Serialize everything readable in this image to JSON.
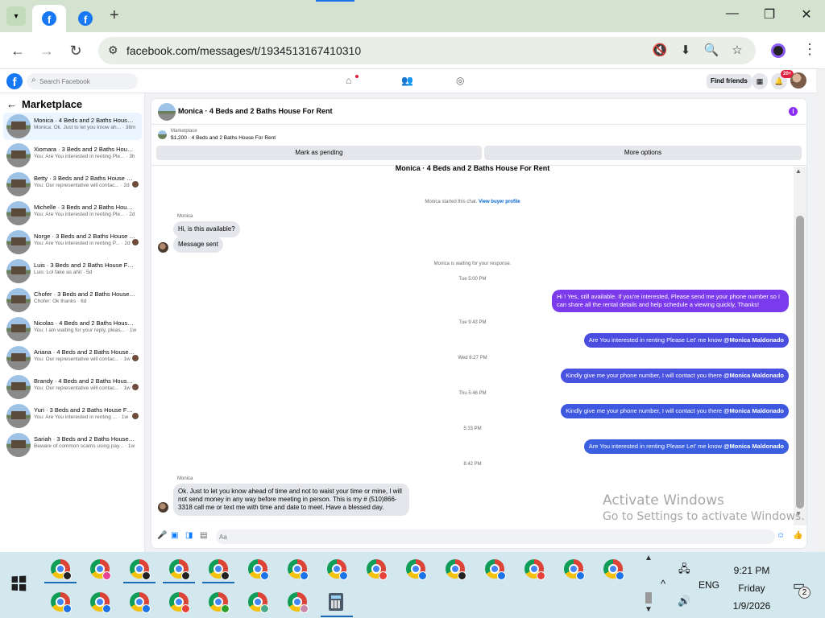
{
  "browser": {
    "url": "facebook.com/messages/t/1934513167410310",
    "tab_favicon": "facebook-icon",
    "new_tab_label": "+",
    "window_controls": [
      "—",
      "❐",
      "✕"
    ]
  },
  "fb": {
    "logo": "f",
    "search_placeholder": "Search Facebook",
    "find_friends": "Find friends",
    "notification_badge": "20+"
  },
  "sidebar": {
    "title": "Marketplace",
    "conversations": [
      {
        "name": "Monica · 4 Beds and 2 Baths House For Rent",
        "snippet": "Monica: Ok. Just to let you know ah... · 38m",
        "selected": true
      },
      {
        "name": "Xiomara · 3 Beds and 2 Baths House For Rent",
        "snippet": "You: Are You interested in renting Ple... · 3h"
      },
      {
        "name": "Betty · 3 Beds and 2 Baths House For Rent",
        "snippet": "You: Our representative will contac... · 2d"
      },
      {
        "name": "Michelle · 3 Beds and 2 Baths House For Rent",
        "snippet": "You: Are You interested in renting Ple... · 2d"
      },
      {
        "name": "Norge · 3 Beds and 2 Baths House For Rent",
        "snippet": "You: Are You interested in renting P... · 2d"
      },
      {
        "name": "Luis · 3 Beds and 2 Baths House For Rent",
        "snippet": "Luis: Lol fake as ahit · 5d"
      },
      {
        "name": "Chofer · 3 Beds and 2 Baths House For Rent",
        "snippet": "Chofer: Ok thanks · 6d"
      },
      {
        "name": "Nicolas · 4 Beds and 2 Baths House For Rent",
        "snippet": "You: I am waiting for your reply, pleas... · 1w"
      },
      {
        "name": "Ariana · 4 Beds and 2 Baths House For Rent",
        "snippet": "You: Our representative will contac... · 1w"
      },
      {
        "name": "Brandy · 4 Beds and 2 Baths House For Rent",
        "snippet": "You: Our representative will contac... · 1w"
      },
      {
        "name": "Yuri · 3 Beds and 2 Baths House For Rent",
        "snippet": "You: Are You interested in renting ... · 1w"
      },
      {
        "name": "Sariah · 3 Beds and 2 Baths House For Rent",
        "snippet": "Beware of common scams using pay... · 1w"
      }
    ]
  },
  "chat": {
    "title": "Monica · 4 Beds and 2 Baths House For Rent",
    "listing_label": "Marketplace",
    "listing_price": "$1,200 · 4 Beds and 2 Baths House For Rent",
    "mark_pending": "Mark as pending",
    "more_options": "More options",
    "thread_title": "Monica · 4 Beds and 2 Baths House For Rent",
    "started_text": "Monica started this chat.",
    "buyer_profile_link": "View buyer profile",
    "sender_name": "Monica",
    "msg_available": "Hi, is this available?",
    "msg_sent": "Message sent",
    "waiting_text": "Monica is waiting for your response.",
    "ts1": "Tue 5:00 PM",
    "out1": "Hi ! Yes, still available. If you're interested, Please send me your phone number so I can share all the rental details and help schedule a viewing quickly, Thanks!",
    "ts2": "Tue 9:43 PM",
    "out2_text": "Are You  interested in renting Please Let' me know ",
    "ts3": "Wed 6:27 PM",
    "out3_text": "Kindly give me your phone number, I will contact you there ",
    "ts4": "Thu 5:46 PM",
    "out4_text": "Kindly give me your phone number, I will contact you there ",
    "ts5": "5:33 PM",
    "out5_text": "Are You  interested in renting Please Let' me know ",
    "mention": "@Monica Maldonado",
    "ts6": "8:42 PM",
    "sender_name_2": "Monica",
    "in_long": "Ok. Just to let you know ahead of time and not to waist your time or mine, I will not send money in any way before meeting in person. This is my # (510)866-3318 call me or text me with time and date to meet. Have a blessed day.",
    "composer_placeholder": "Aa",
    "colors": {
      "bubble_purple": "#7c3aed",
      "bubble_blue": "#3b5bdb",
      "incoming": "#e4e6eb"
    }
  },
  "watermark": {
    "line1": "Activate Windows",
    "line2": "Go to Settings to activate Windows."
  },
  "taskbar": {
    "language": "ENG",
    "time": "9:21 PM",
    "day": "Friday",
    "date": "1/9/2026",
    "notification_count": "2"
  }
}
